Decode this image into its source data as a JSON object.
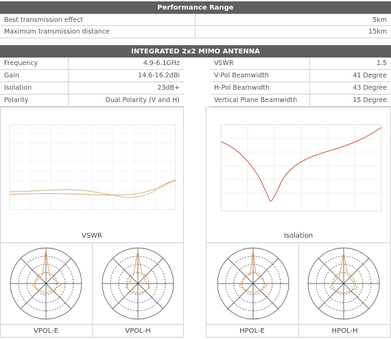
{
  "performance": {
    "title": "Performance Range",
    "rows": [
      {
        "label": "Best transmission effect",
        "value": "5km"
      },
      {
        "label": "Maximum transmission distance",
        "value": "15km"
      }
    ]
  },
  "antenna": {
    "title": "INTEGRATED 2x2 MIMO ANTENNA",
    "left_rows": [
      {
        "label": "Frequency",
        "value": "4.9-6.1GHz"
      },
      {
        "label": "Gain",
        "value": "14.6-16.2dBi"
      },
      {
        "label": "Isolation",
        "value": "23dB+"
      },
      {
        "label": "Polarity",
        "value": "Dual Polarity (V and H)"
      }
    ],
    "right_rows": [
      {
        "label": "VSWR",
        "value": "1.5"
      },
      {
        "label": "V-Pol Beamwidth",
        "value": "41 Degree"
      },
      {
        "label": "H-Pol Beamwidth",
        "value": "43 Degree"
      },
      {
        "label": "Vertical Plane Beamwidth",
        "value": "15 Degree"
      }
    ]
  },
  "charts": {
    "vswr_caption": "VSWR",
    "isolation_caption": "Isolation",
    "polar_captions": [
      "VPOL-E",
      "VPOL-H",
      "HPOL-E",
      "HPOL-H"
    ]
  },
  "colors": {
    "header_bg": "#5f5f5f",
    "curve_orange": "#e8a15a",
    "curve_olive": "#c2b98c",
    "curve_red": "#d6483a"
  }
}
